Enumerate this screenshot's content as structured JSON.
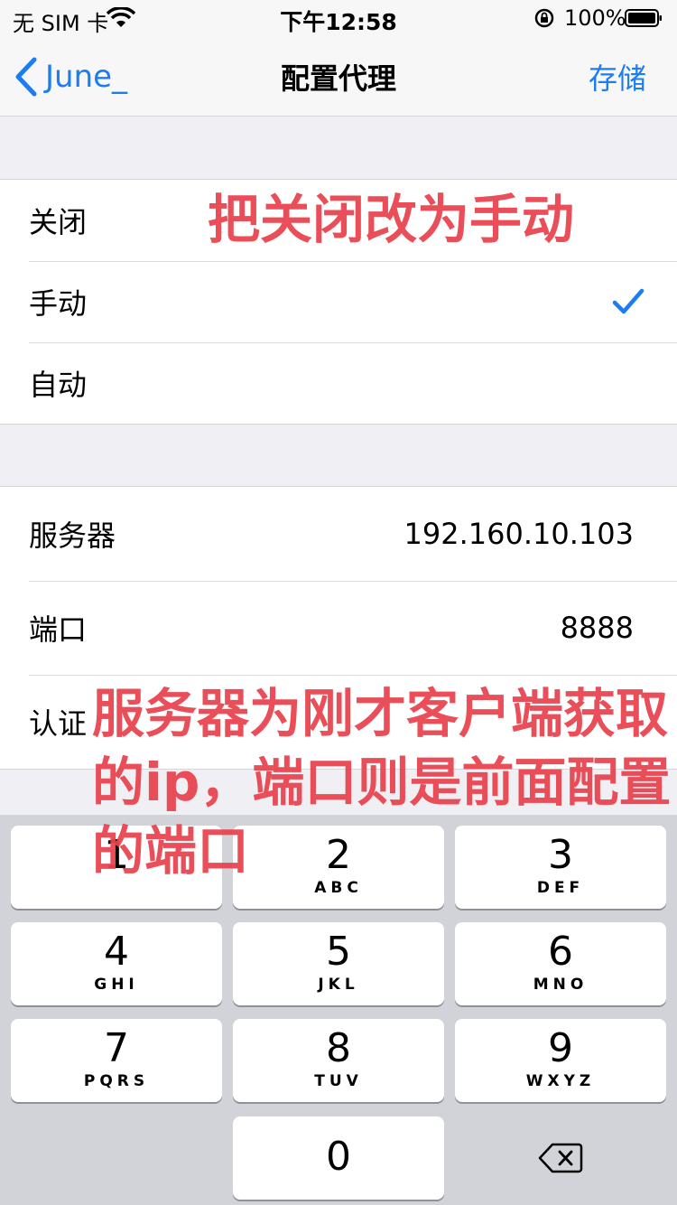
{
  "status_bar": {
    "carrier": "无 SIM 卡",
    "time": "下午12:58",
    "battery": "100%"
  },
  "nav": {
    "back_label": "June_",
    "title": "配置代理",
    "save_label": "存储"
  },
  "proxy_modes": [
    {
      "label": "关闭",
      "selected": false
    },
    {
      "label": "手动",
      "selected": true
    },
    {
      "label": "自动",
      "selected": false
    }
  ],
  "settings": {
    "server_label": "服务器",
    "server_value": "192.160.10.103",
    "port_label": "端口",
    "port_value": "8888",
    "auth_label": "认证"
  },
  "keypad": [
    {
      "digit": "1",
      "letters": ""
    },
    {
      "digit": "2",
      "letters": "ABC"
    },
    {
      "digit": "3",
      "letters": "DEF"
    },
    {
      "digit": "4",
      "letters": "GHI"
    },
    {
      "digit": "5",
      "letters": "JKL"
    },
    {
      "digit": "6",
      "letters": "MNO"
    },
    {
      "digit": "7",
      "letters": "PQRS"
    },
    {
      "digit": "8",
      "letters": "TUV"
    },
    {
      "digit": "9",
      "letters": "WXYZ"
    },
    {
      "digit": "0",
      "letters": ""
    }
  ],
  "annotations": {
    "top": "把关闭改为手动",
    "bottom": "服务器为刚才客户端获取的ip，端口则是前面配置的端口"
  },
  "colors": {
    "accent": "#1c7cf3",
    "annotation": "#e8434f"
  },
  "icons": [
    "wifi-icon",
    "orientation-lock-icon",
    "battery-icon",
    "back-chevron-icon",
    "checkmark-icon",
    "delete-icon"
  ]
}
